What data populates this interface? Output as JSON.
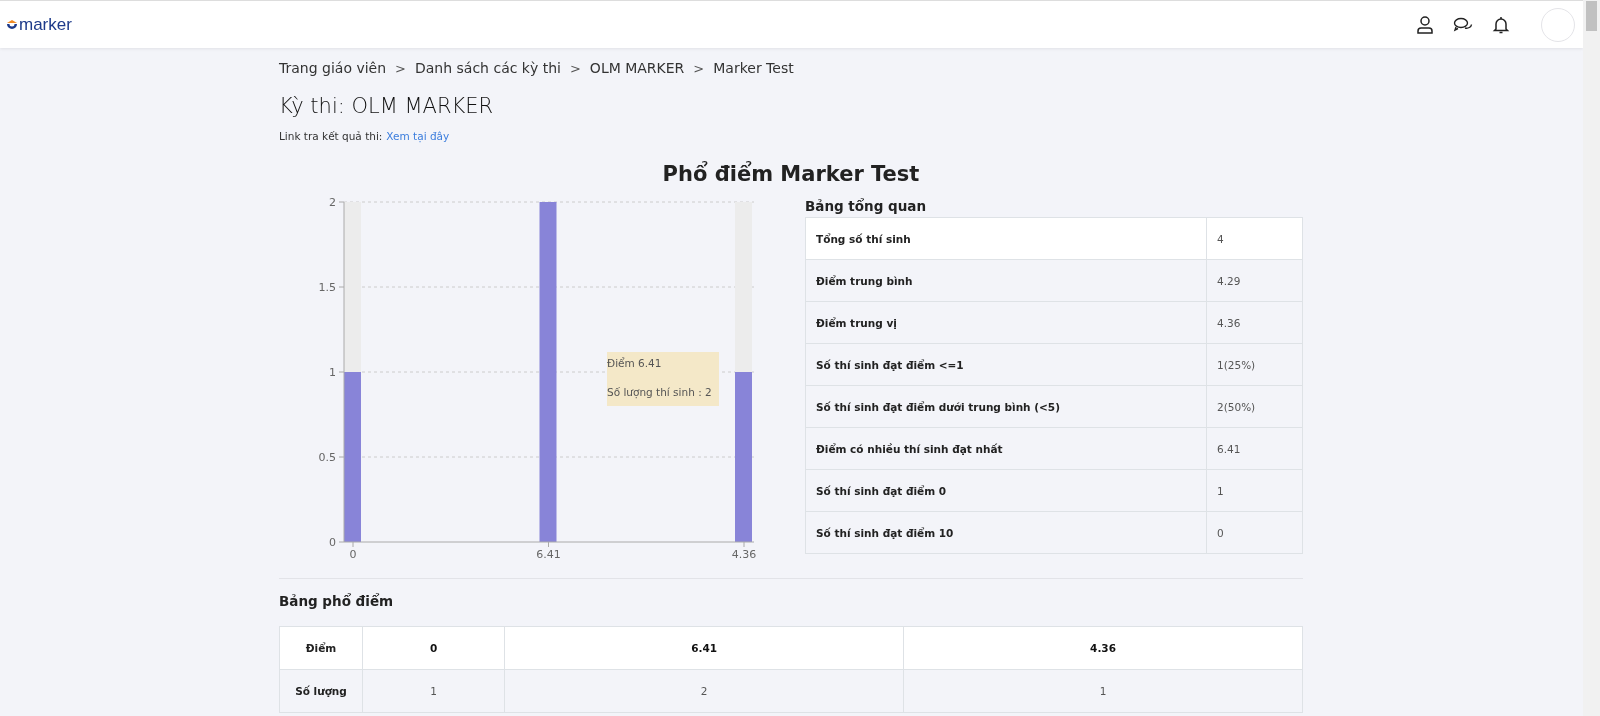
{
  "header": {
    "logo": "marker"
  },
  "breadcrumb": [
    "Trang giáo viên",
    "Danh sách các kỳ thi",
    "OLM MARKER",
    "Marker Test"
  ],
  "breadcrumb_separator": ">",
  "title": "Kỳ thi: OLM MARKER",
  "result_link": {
    "label": "Link tra kết quả thi:",
    "link": "Xem tại đây"
  },
  "chart_title": "Phổ điểm Marker Test",
  "chart": {
    "chart_data": {
      "type": "bar",
      "categories": [
        "0",
        "6.41",
        "4.36"
      ],
      "series": [
        {
          "name": "Số lượng thí sinh",
          "color": "#8884d8",
          "values": [
            1,
            2,
            1
          ]
        }
      ],
      "ylim": [
        0,
        2
      ],
      "grid": true,
      "yticks": [
        0,
        {
          "value": 0.5,
          "label": "0.5"
        },
        1,
        {
          "value": 1.5,
          "label": "1.5"
        },
        2
      ]
    },
    "tooltip": {
      "title": "Điểm 6.41",
      "separator": " : ",
      "value": "2"
    }
  },
  "overview": {
    "title": "Bảng tổng quan",
    "rows": [
      {
        "label": "Tổng số thí sinh",
        "value": "4"
      },
      {
        "label": "Điểm trung bình",
        "value": "4.29"
      },
      {
        "label": "Điểm trung vị",
        "value": "4.36"
      },
      {
        "label": "Số thí sinh đạt điểm <=1",
        "value": "1(25%)"
      },
      {
        "label": "Số thí sinh đạt điểm dưới trung bình (<5)",
        "value": "2(50%)"
      },
      {
        "label": "Điểm có nhiều thí sinh đạt nhất",
        "value": "6.41"
      },
      {
        "label": "Số thí sinh đạt điểm 0",
        "value": "1"
      },
      {
        "label": "Số thí sinh đạt điểm 10",
        "value": "0"
      }
    ]
  },
  "distribution": {
    "title": "Bảng phổ điểm",
    "rows": [
      {
        "header": "Điểm",
        "cells": [
          "0",
          "6.41",
          "4.36"
        ]
      },
      {
        "header": "Số lượng",
        "cells": [
          "1",
          "2",
          "1"
        ]
      }
    ]
  }
}
